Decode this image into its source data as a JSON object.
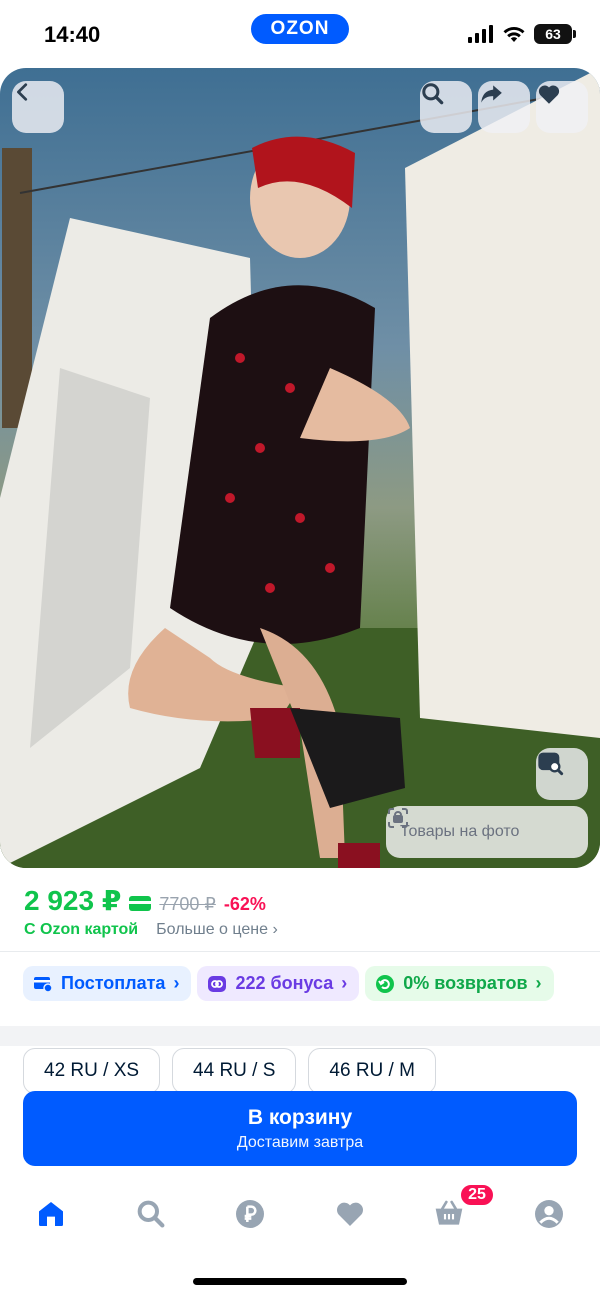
{
  "status_bar": {
    "time": "14:40",
    "battery": "63",
    "logo": "OZON"
  },
  "photo": {
    "description_icons": [
      "back-icon",
      "search-icon",
      "share-icon",
      "heart-icon",
      "image-search-icon",
      "scan-icon"
    ],
    "products_on_photo": "Товары на фото"
  },
  "price": {
    "current": "2 923 ₽",
    "old": "7700 ₽",
    "discount": "-62%",
    "with_card": "С Ozon картой",
    "more_about_price": "Больше о цене ›"
  },
  "chips": [
    {
      "label": "Постоплата",
      "icon": "postpay-icon"
    },
    {
      "label": "222 бонуса",
      "icon": "bonus-icon"
    },
    {
      "label": "0% возвратов",
      "icon": "return-icon"
    }
  ],
  "sizes": [
    "42 RU / XS",
    "44 RU / S",
    "46 RU / M"
  ],
  "cart_button": {
    "title": "В корзину",
    "subtitle": "Доставим завтра"
  },
  "bottom_nav": {
    "items": [
      "home-icon",
      "search-icon",
      "ruble-icon",
      "heart-icon",
      "cart-icon",
      "profile-icon"
    ],
    "cart_count": "25"
  },
  "colors": {
    "brand": "#005bff",
    "price_green": "#10c44c",
    "discount_pink": "#f91155"
  }
}
